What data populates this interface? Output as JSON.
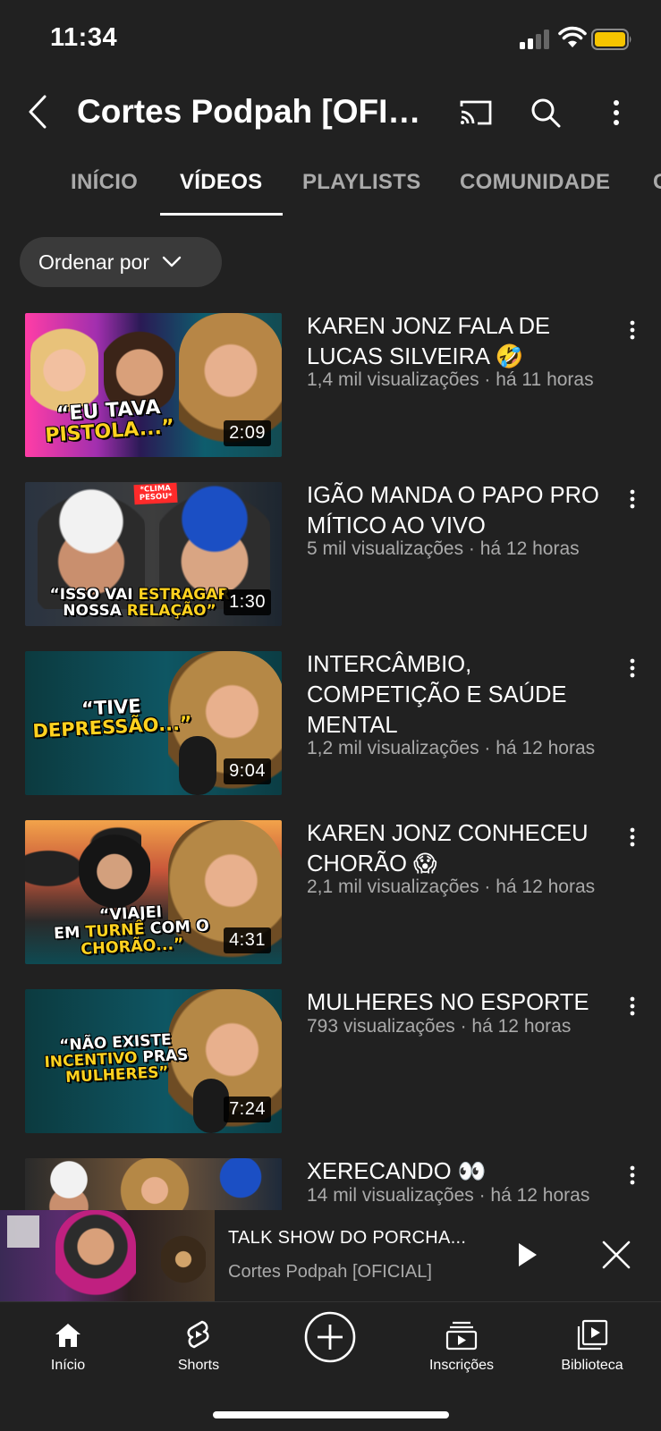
{
  "status_bar": {
    "time": "11:34",
    "battery_color": "#f5c400"
  },
  "header": {
    "title": "Cortes Podpah [OFICIAL]",
    "icons": [
      "back-icon",
      "cast-icon",
      "search-icon",
      "more-vertical-icon"
    ]
  },
  "tabs": [
    {
      "label": "INÍCIO",
      "active": false
    },
    {
      "label": "VÍDEOS",
      "active": true
    },
    {
      "label": "PLAYLISTS",
      "active": false
    },
    {
      "label": "COMUNIDADE",
      "active": false
    },
    {
      "label": "C",
      "active": false
    }
  ],
  "sort": {
    "label": "Ordenar por"
  },
  "videos": [
    {
      "title": "KAREN JONZ FALA DE LUCAS SILVEIRA 🤣",
      "meta": "1,4 mil visualizações · há 11 horas",
      "duration": "2:09",
      "thumb_caption_1": "“EU TAVA",
      "thumb_caption_2": "PISTOLA...”"
    },
    {
      "title": "IGÃO MANDA O PAPO PRO MÍTICO AO VIVO",
      "meta": "5 mil visualizações · há 12 horas",
      "duration": "1:30",
      "thumb_badge": "*CLIMA PESOU*",
      "thumb_caption_1a": "“ISSO VAI ",
      "thumb_caption_1b": "ESTRAGAR",
      "thumb_caption_2a": "NOSSA ",
      "thumb_caption_2b": "RELAÇÃO”"
    },
    {
      "title": "INTERCÂMBIO, COMPETIÇÃO E SAÚDE MENTAL",
      "meta": "1,2 mil visualizações · há 12 horas",
      "duration": "9:04",
      "thumb_caption_1": "“TIVE",
      "thumb_caption_2": "DEPRESSÃO...”"
    },
    {
      "title": "KAREN JONZ CONHECEU CHORÃO 😱",
      "meta": "2,1 mil visualizações · há 12 horas",
      "duration": "4:31",
      "thumb_caption_1": "“VIAJEI",
      "thumb_caption_2a": "EM ",
      "thumb_caption_2b": "TURNÊ",
      "thumb_caption_2c": " COM O",
      "thumb_caption_3": "CHORÃO...”"
    },
    {
      "title": "MULHERES NO ESPORTE",
      "meta": "793 visualizações · há 12 horas",
      "duration": "7:24",
      "thumb_caption_1": "“NÃO EXISTE",
      "thumb_caption_2a": "INCENTIVO",
      "thumb_caption_2b": " PRAS",
      "thumb_caption_3": "MULHERES”"
    },
    {
      "title": "XERECANDO 👀",
      "meta": "14 mil visualizações · há 12 horas"
    }
  ],
  "mini_player": {
    "title": "TALK SHOW DO PORCHA...",
    "channel": "Cortes Podpah [OFICIAL]"
  },
  "bottom_nav": [
    {
      "label": "Início",
      "icon": "home-icon"
    },
    {
      "label": "Shorts",
      "icon": "shorts-icon"
    },
    {
      "label": "",
      "icon": "create-plus-icon"
    },
    {
      "label": "Inscrições",
      "icon": "subscriptions-icon"
    },
    {
      "label": "Biblioteca",
      "icon": "library-icon"
    }
  ]
}
